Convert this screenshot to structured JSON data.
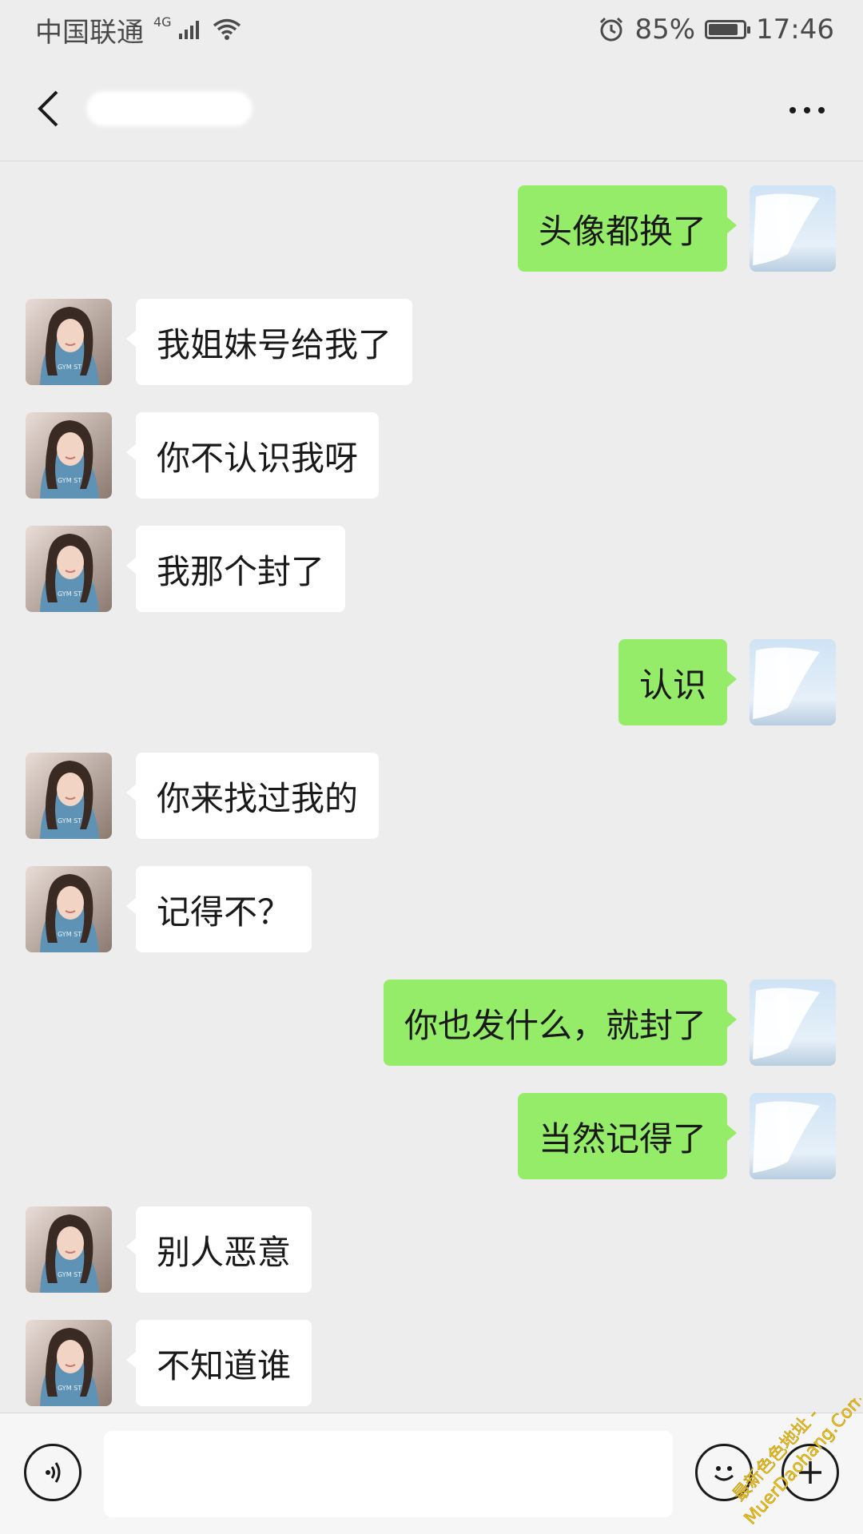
{
  "status_bar": {
    "carrier": "中国联通",
    "network": "4G",
    "battery": "85%",
    "battery_level": 0.85,
    "time": "17:46"
  },
  "header": {
    "back_icon": "chevron-left-icon",
    "more_icon": "ellipsis-icon"
  },
  "messages": [
    {
      "side": "out",
      "text": "头像都换了"
    },
    {
      "side": "in",
      "text": "我姐妹号给我了"
    },
    {
      "side": "in",
      "text": "你不认识我呀"
    },
    {
      "side": "in",
      "text": "我那个封了"
    },
    {
      "side": "out",
      "text": "认识"
    },
    {
      "side": "in",
      "text": "你来找过我的"
    },
    {
      "side": "in",
      "text": "记得不？"
    },
    {
      "side": "out",
      "text": "你也发什么，就封了"
    },
    {
      "side": "out",
      "text": "当然记得了"
    },
    {
      "side": "in",
      "text": "别人恶意"
    },
    {
      "side": "in",
      "text": "不知道谁"
    }
  ],
  "input_bar": {
    "voice_icon": "voice-icon",
    "emoji_icon": "emoji-icon",
    "plus_icon": "plus-icon",
    "value": ""
  },
  "watermark": {
    "line1": "最新色色地址 -",
    "line2": "MuerDaohang.Com"
  },
  "colors": {
    "background": "#ededed",
    "bubble_out": "#95ec69",
    "bubble_in": "#ffffff"
  }
}
